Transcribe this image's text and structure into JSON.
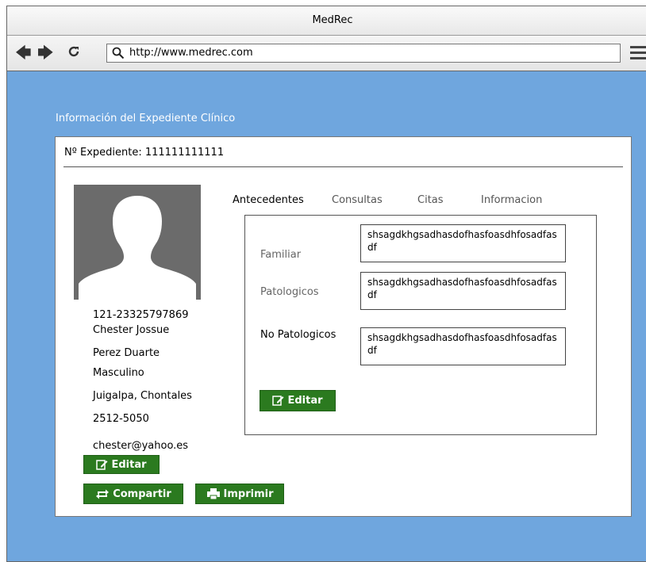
{
  "window": {
    "title": "MedRec"
  },
  "browser": {
    "url": "http://www.medrec.com"
  },
  "page": {
    "section_title": "Información del Expediente Clínico",
    "expediente_label": "Nº Expediente: 111111111111"
  },
  "patient": {
    "id": "121-23325797869",
    "first_name": "Chester Jossue",
    "last_name": "Perez Duarte",
    "gender": "Masculino",
    "location": "Juigalpa, Chontales",
    "phone": "2512-5050",
    "email": "chester@yahoo.es"
  },
  "actions": {
    "edit": "Editar",
    "share": "Compartir",
    "print": "Imprimir"
  },
  "tabs": [
    {
      "label": "Antecedentes",
      "active": true
    },
    {
      "label": "Consultas",
      "active": false
    },
    {
      "label": "Citas",
      "active": false
    },
    {
      "label": "Informacion",
      "active": false
    }
  ],
  "antecedentes": {
    "fields": [
      {
        "label": "Familiar",
        "value": "shsagdkhgsadhasdofhasfoasdhfosadfasdf"
      },
      {
        "label": "Patologicos",
        "value": "shsagdkhgsadhasdofhasfoasdhfosadfasdf"
      },
      {
        "label": "No Patologicos",
        "value": "shsagdkhgsadhasdofhasfoasdhfosadfasdf"
      }
    ],
    "edit_label": "Editar"
  },
  "colors": {
    "background": "#6fa6de",
    "button": "#2b7a1f"
  },
  "icons": {
    "back": "arrow-left-icon",
    "forward": "arrow-right-icon",
    "reload": "reload-icon",
    "search": "search-icon",
    "menu": "hamburger-menu-icon",
    "edit": "edit-icon",
    "share": "share-icon",
    "print": "print-icon",
    "avatar": "user-silhouette-icon"
  }
}
